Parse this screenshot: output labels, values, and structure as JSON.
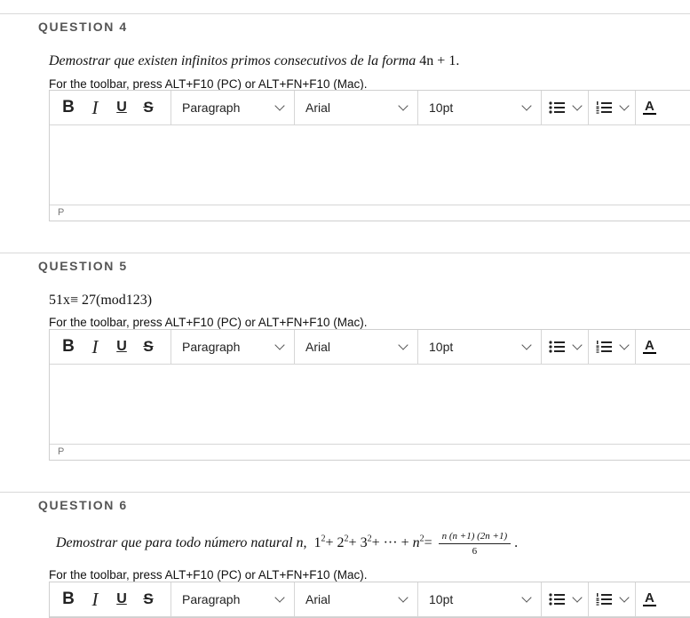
{
  "toolbar_hint": "For the toolbar, press ALT+F10 (PC) or ALT+FN+F10 (Mac).",
  "toolbar": {
    "bold": "B",
    "italic": "I",
    "underline": "U",
    "strike": "S",
    "paragraph": "Paragraph",
    "font": "Arial",
    "size": "10pt",
    "text_color": "A"
  },
  "status_path": "P",
  "questions": [
    {
      "title": "QUESTION 4",
      "text_prefix": "Demostrar que existen infinitos primos consecutivos de la forma ",
      "text_math": "4n + 1."
    },
    {
      "title": "QUESTION 5",
      "text": "51x≡ 27(mod123)"
    },
    {
      "title": "QUESTION 6",
      "text_prefix": "Demostrar que para todo número natural ",
      "text_var": "n",
      "frac_num": "n (n +1) (2n +1)",
      "frac_den": "6"
    }
  ]
}
